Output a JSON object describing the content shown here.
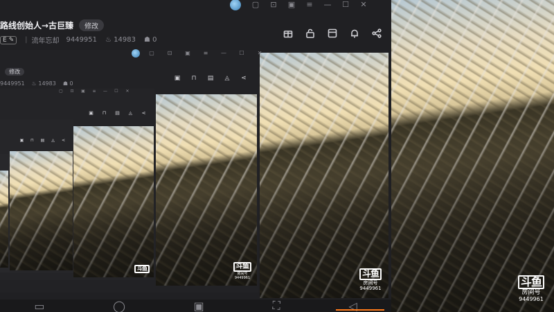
{
  "room": {
    "title": "路线创始人→古巨臻",
    "edit_label": "修改",
    "tag_label": "E",
    "streamer": "流年忘却",
    "room_id": "9449951",
    "heat": "14983",
    "fans": "0"
  },
  "watermark": {
    "logo": "斗鱼",
    "sub": "房间号",
    "room_id": "9449961"
  },
  "titlebar_icons": [
    "avatar-icon",
    "box-icon",
    "monitor-icon",
    "archive-icon",
    "menu-icon",
    "minimize-icon",
    "maximize-icon",
    "close-icon"
  ],
  "toolbar_icons": [
    "gift-box-icon",
    "lock-icon",
    "layout-icon",
    "bell-icon",
    "share-icon"
  ],
  "colors": {
    "accent": "#ff7a1a",
    "chrome": "#202023",
    "text": "#d8d8dc"
  }
}
